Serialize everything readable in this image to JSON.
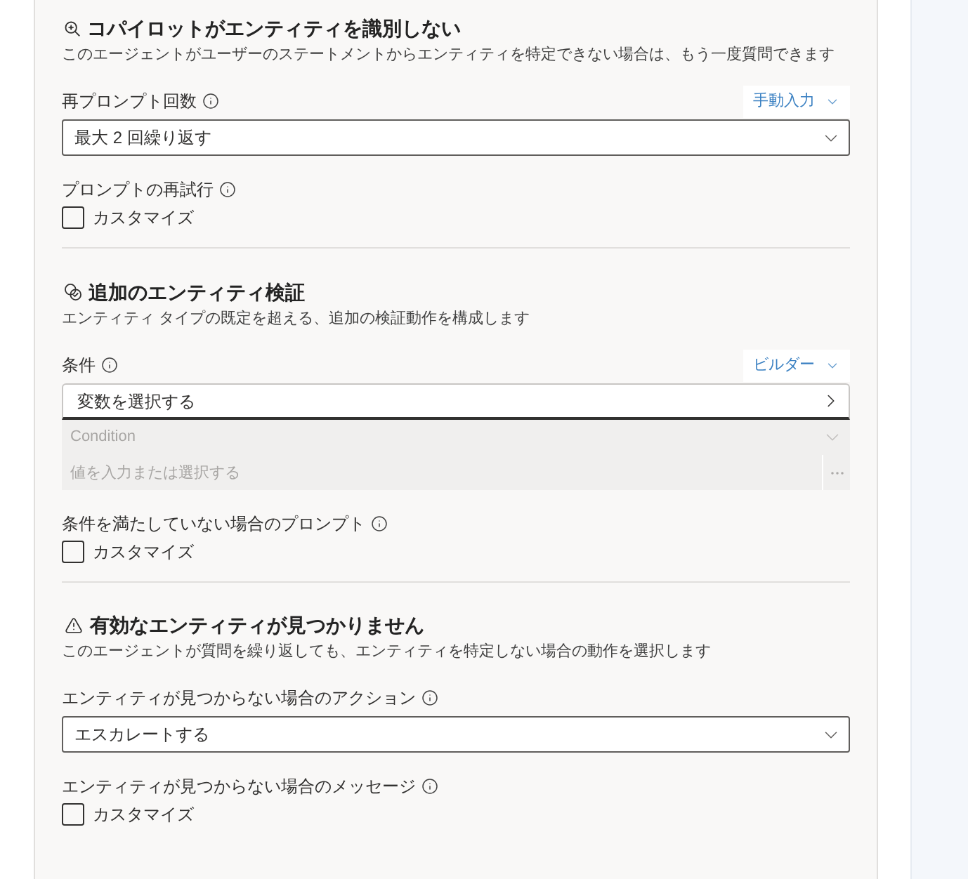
{
  "sections": [
    {
      "title": "コパイロットがエンティティを識別しない",
      "description": "このエージェントがユーザーのステートメントからエンティティを特定できない場合は、もう一度質問できます",
      "fields": [
        {
          "kind": "dropdown",
          "label": "再プロンプト回数",
          "mode": "手動入力",
          "value": "最大 2 回繰り返す"
        },
        {
          "kind": "checkbox",
          "label": "プロンプトの再試行",
          "option": "カスタマイズ",
          "checked": false
        }
      ]
    },
    {
      "title": "追加のエンティティ検証",
      "description": "エンティティ タイプの既定を超える、追加の検証動作を構成します",
      "fields": [
        {
          "kind": "condition",
          "label": "条件",
          "mode": "ビルダー",
          "variable": "変数を選択する",
          "operator": {
            "placeholder": "Condition",
            "disabled": true
          },
          "operand": {
            "placeholder": "値を入力または選択する",
            "disabled": true
          }
        },
        {
          "kind": "checkbox",
          "label": "条件を満たしていない場合のプロンプト",
          "option": "カスタマイズ",
          "checked": false
        }
      ]
    },
    {
      "title": "有効なエンティティが見つかりません",
      "description": "このエージェントが質問を繰り返しても、エンティティを特定しない場合の動作を選択します",
      "fields": [
        {
          "kind": "dropdown",
          "label": "エンティティが見つからない場合のアクション",
          "value": "エスカレートする"
        },
        {
          "kind": "checkbox",
          "label": "エンティティが見つからない場合のメッセージ",
          "option": "カスタマイズ",
          "checked": false
        }
      ]
    }
  ]
}
